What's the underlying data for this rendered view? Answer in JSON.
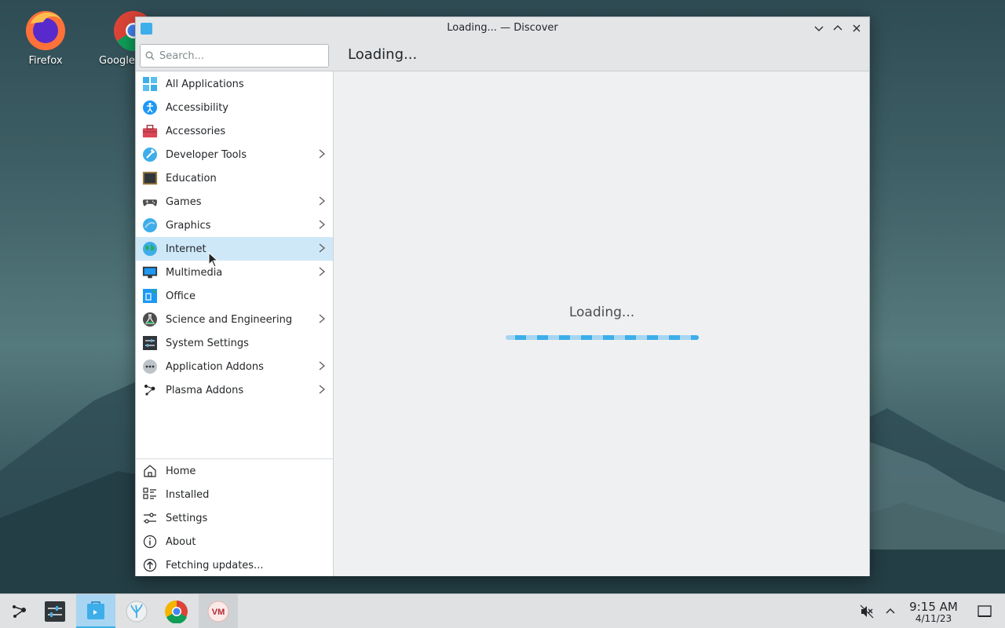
{
  "desktop": {
    "icons": [
      {
        "label": "Firefox"
      },
      {
        "label": "Google"
      }
    ]
  },
  "window": {
    "title": "Loading... — Discover",
    "search_placeholder": "Search...",
    "page_title": "Loading...",
    "categories": [
      {
        "label": "All Applications",
        "icon": "grid-icon",
        "has_submenu": false
      },
      {
        "label": "Accessibility",
        "icon": "accessibility-icon",
        "has_submenu": false
      },
      {
        "label": "Accessories",
        "icon": "toolbox-icon",
        "has_submenu": false
      },
      {
        "label": "Developer Tools",
        "icon": "hammer-icon",
        "has_submenu": true
      },
      {
        "label": "Education",
        "icon": "chalkboard-icon",
        "has_submenu": false
      },
      {
        "label": "Games",
        "icon": "gamepad-icon",
        "has_submenu": true
      },
      {
        "label": "Graphics",
        "icon": "palette-icon",
        "has_submenu": true
      },
      {
        "label": "Internet",
        "icon": "globe-icon",
        "has_submenu": true
      },
      {
        "label": "Multimedia",
        "icon": "monitor-icon",
        "has_submenu": true
      },
      {
        "label": "Office",
        "icon": "document-icon",
        "has_submenu": false
      },
      {
        "label": "Science and Engineering",
        "icon": "flask-icon",
        "has_submenu": true
      },
      {
        "label": "System Settings",
        "icon": "settings-panel-icon",
        "has_submenu": false
      },
      {
        "label": "Application Addons",
        "icon": "dots-icon",
        "has_submenu": true
      },
      {
        "label": "Plasma Addons",
        "icon": "plasma-icon",
        "has_submenu": true
      }
    ],
    "nav": [
      {
        "label": "Home",
        "icon": "home-icon"
      },
      {
        "label": "Installed",
        "icon": "installed-icon"
      },
      {
        "label": "Settings",
        "icon": "sliders-icon"
      },
      {
        "label": "About",
        "icon": "info-icon"
      },
      {
        "label": "Fetching updates...",
        "icon": "update-arrow-icon"
      }
    ],
    "content_loading_text": "Loading...",
    "active_category": "Internet"
  },
  "taskbar": {
    "clock_time": "9:15 AM",
    "clock_date": "4/11/23"
  },
  "colors": {
    "accent": "#3daee9",
    "selection": "#cfe8f8"
  }
}
